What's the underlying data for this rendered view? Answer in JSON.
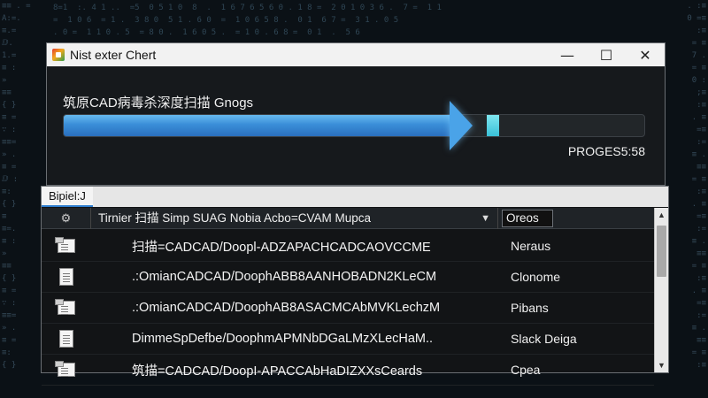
{
  "window": {
    "title": "Nist exter Chert",
    "minimize_glyph": "—",
    "maximize_glyph": "☐",
    "close_glyph": "✕"
  },
  "scan": {
    "label": "筑原CAD病毒杀深度扫描 Gnogs",
    "progress_text": "PROGES5:58",
    "progress_fraction": 0.75
  },
  "panel": {
    "tab_label": "Bipiel:J",
    "columns": {
      "path_header": "Tirnier 扫描 Simp SUAG Nobia Acbo=CVAM Mupca",
      "status_header": "Oreos",
      "caret": "▼"
    },
    "rows": [
      {
        "icon": "file-stack-icon",
        "path": "扫描=CADCAD/Doopl-ADZAPACHCADCAOVCCME",
        "status": "Neraus"
      },
      {
        "icon": "file-document-icon",
        "path": ".:OmianCADCAD/DoophABB8AANHOBADN2KLeCM",
        "status": "Clonome"
      },
      {
        "icon": "file-stack-icon",
        "path": ".:OmianCADCAD/DoophAB8ASACMCAbMVKLechzM",
        "status": "Pibans"
      },
      {
        "icon": "file-document-icon",
        "path": "DimmeSpDefbe/DoophmAPMNbDGaLMzXLecHaM..",
        "status": "Slack Deiga"
      },
      {
        "icon": "file-stack-icon",
        "path": "筑描=CADCAD/DoopI-APACCAbHaDIZXXsCeards",
        "status": "Cpea"
      }
    ]
  },
  "scrollbar": {
    "up_glyph": "▲",
    "down_glyph": "▼"
  },
  "colors": {
    "progress_blue": "#3a8ed8",
    "progress_tip": "#39c1d8",
    "tab_accent": "#2f7fd0",
    "background": "#0b1116"
  }
}
